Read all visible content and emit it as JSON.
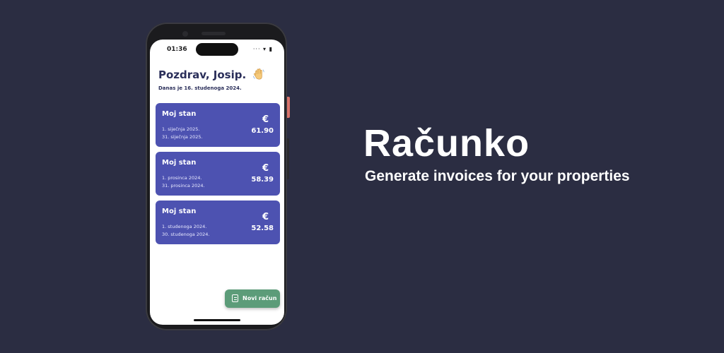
{
  "brand": {
    "name": "Računko",
    "tagline": "Generate invoices for your properties"
  },
  "phone": {
    "status_time": "01:36",
    "status_icons": "··· ▾ ▮",
    "greeting": "Pozdrav, Josip.",
    "greeting_icon": "waving-hand-icon",
    "date_line": "Danas je 16. studenoga 2024.",
    "cards": [
      {
        "title": "Moj stan",
        "date_from": "1. siječnja 2025.",
        "date_to": "31. siječnja 2025.",
        "currency": "€",
        "amount": "61.90"
      },
      {
        "title": "Moj stan",
        "date_from": "1. prosinca 2024.",
        "date_to": "31. prosinca 2024.",
        "currency": "€",
        "amount": "58.39"
      },
      {
        "title": "Moj stan",
        "date_from": "1. studenoga 2024.",
        "date_to": "30. studenoga 2024.",
        "currency": "€",
        "amount": "52.58"
      }
    ],
    "fab_label": "Novi račun",
    "fab_icon": "document-icon"
  },
  "colors": {
    "background": "#2b2d42",
    "card": "#4d52b1",
    "fab": "#5c9c79",
    "heading": "#2b2f5a"
  }
}
